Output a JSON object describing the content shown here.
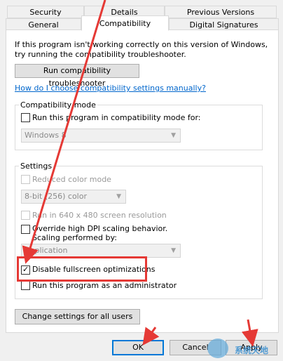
{
  "tabs": {
    "security": "Security",
    "details": "Details",
    "previous_versions": "Previous Versions",
    "general": "General",
    "compatibility": "Compatibility",
    "digital_signatures": "Digital Signatures"
  },
  "intro": {
    "line1": "If this program isn't working correctly on this version of Windows,",
    "line2": "try running the compatibility troubleshooter."
  },
  "buttons": {
    "troubleshooter": "Run compatibility troubleshooter",
    "change_all_users": "Change settings for all users",
    "ok": "OK",
    "cancel": "Cancel",
    "apply": "Apply"
  },
  "link_manual": "How do I choose compatibility settings manually?",
  "compat_mode": {
    "title": "Compatibility mode",
    "checkbox_label": "Run this program in compatibility mode for:",
    "checked": false,
    "select_value": "Windows 8"
  },
  "settings": {
    "title": "Settings",
    "reduced_color": {
      "label": "Reduced color mode",
      "checked": false
    },
    "color_select": "8-bit (256) color",
    "res_640": {
      "label": "Run in 640 x 480 screen resolution",
      "checked": false
    },
    "dpi": {
      "label_line1": "Override high DPI scaling behavior.",
      "label_line2": "Scaling performed by:",
      "checked": false
    },
    "dpi_select": "Application",
    "fullscreen": {
      "label": "Disable fullscreen optimizations",
      "checked": true
    },
    "admin": {
      "label": "Run this program as an administrator",
      "checked": false
    }
  },
  "watermark": "系统天地",
  "colors": {
    "annotation_red": "#e53935",
    "link_blue": "#0066cc",
    "focus_blue": "#0078d7"
  },
  "check_glyph": "✓"
}
